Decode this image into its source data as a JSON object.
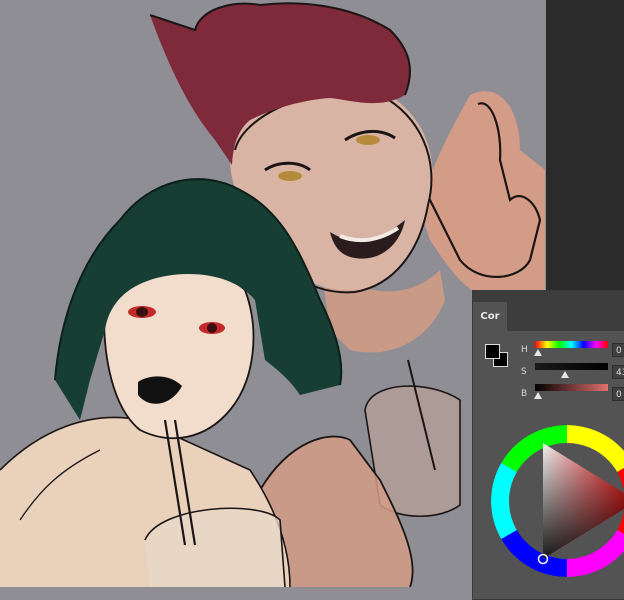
{
  "panel": {
    "tab_label": "Cor",
    "foreground_color": "#000000",
    "background_color": "#000000",
    "channels": [
      {
        "label": "H",
        "value": "0"
      },
      {
        "label": "S",
        "value": "43"
      },
      {
        "label": "B",
        "value": "0"
      }
    ]
  },
  "colors": {
    "canvas": "#8f8e95",
    "hair_red": "#7e2a3a",
    "hair_green": "#173e33",
    "skin_light": "#f2dccb",
    "skin_tan": "#cf9e88",
    "panel_bg": "#535353"
  }
}
